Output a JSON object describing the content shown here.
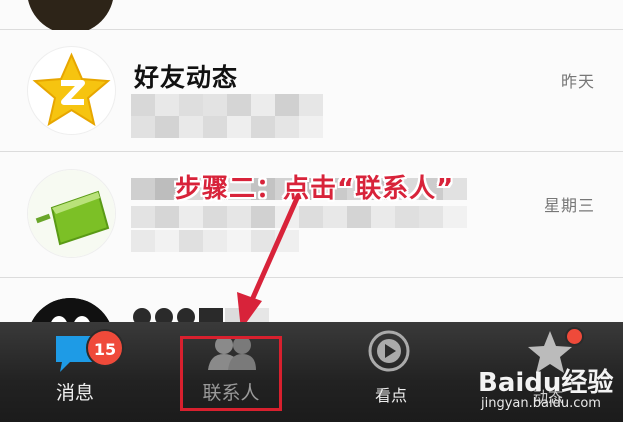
{
  "conversations": [
    {
      "name": "",
      "time": ""
    },
    {
      "name": "好友动态",
      "time": "昨天"
    },
    {
      "name": "",
      "time": "星期三"
    },
    {
      "name": "",
      "time": ""
    }
  ],
  "annotation": {
    "text": "步骤二：点击“联系人”"
  },
  "tabbar": {
    "tabs": [
      {
        "label": "消息",
        "icon": "message-icon",
        "badge": "15"
      },
      {
        "label": "联系人",
        "icon": "contacts-icon"
      },
      {
        "label": "看点",
        "icon": "play-icon"
      },
      {
        "label": "动态",
        "icon": "star-icon"
      }
    ]
  },
  "watermark": {
    "brand": "Baidu经验",
    "url": "jingyan.baidu.com"
  },
  "colors": {
    "accent_red": "#d8202e",
    "badge_red": "#ef4a3a",
    "tabbar_bg": "#222222",
    "qzone_yellow": "#f6c410",
    "green": "#7cc026"
  }
}
